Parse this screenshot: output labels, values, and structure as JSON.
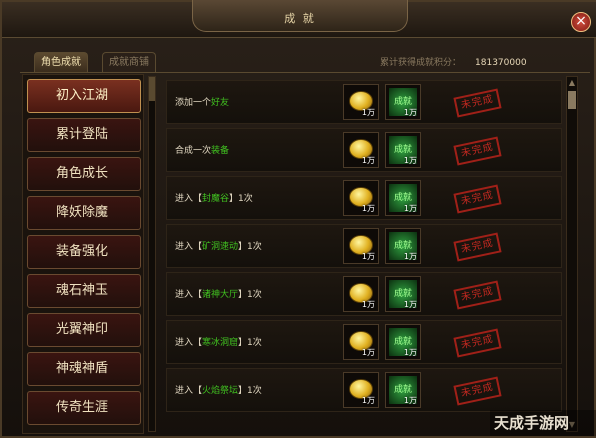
{
  "window": {
    "title": "成 就"
  },
  "tabs": [
    {
      "label": "角色成就",
      "active": true
    },
    {
      "label": "成就商铺",
      "active": false
    }
  ],
  "score": {
    "label": "累计获得成就积分：",
    "value": "181370000"
  },
  "categories": [
    {
      "label": "初入江湖",
      "selected": true
    },
    {
      "label": "累计登陆",
      "selected": false
    },
    {
      "label": "角色成长",
      "selected": false
    },
    {
      "label": "降妖除魔",
      "selected": false
    },
    {
      "label": "装备强化",
      "selected": false
    },
    {
      "label": "魂石神玉",
      "selected": false
    },
    {
      "label": "光翼神印",
      "selected": false
    },
    {
      "label": "神魂神盾",
      "selected": false
    },
    {
      "label": "传奇生涯",
      "selected": false
    }
  ],
  "rewards_common": {
    "coin_qty": "1万",
    "ach_label": "成就",
    "ach_qty": "1万",
    "status": "未完成"
  },
  "achievements": [
    {
      "prefix": "添加一个",
      "highlight": "好友",
      "suffix": ""
    },
    {
      "prefix": "合成一次",
      "highlight": "装备",
      "suffix": ""
    },
    {
      "prefix": "进入【",
      "highlight": "封魔谷",
      "suffix": "】1次"
    },
    {
      "prefix": "进入【",
      "highlight": "矿洞速动",
      "suffix": "】1次"
    },
    {
      "prefix": "进入【",
      "highlight": "诸神大厅",
      "suffix": "】1次"
    },
    {
      "prefix": "进入【",
      "highlight": "寒冰洞窟",
      "suffix": "】1次"
    },
    {
      "prefix": "进入【",
      "highlight": "火焰祭坛",
      "suffix": "】1次"
    }
  ],
  "colors": {
    "highlight": "#40c020",
    "status": "#c02820",
    "accent": "#c09050"
  },
  "icons": {
    "close": "close-icon",
    "coin": "gold-coin-icon",
    "achievement": "achievement-badge-icon",
    "scroll_up": "arrow-up-icon",
    "scroll_down": "arrow-down-icon"
  },
  "watermark": "天成手游网"
}
